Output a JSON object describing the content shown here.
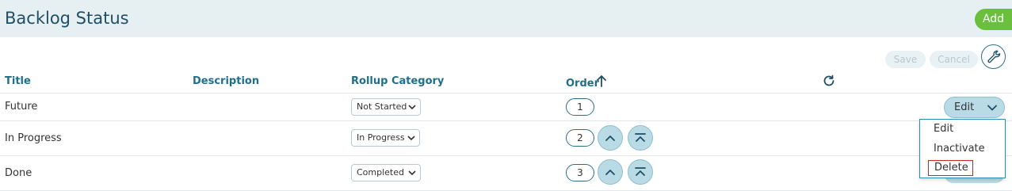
{
  "header": {
    "title": "Backlog Status",
    "add_label": "Add"
  },
  "toolbar": {
    "save_label": "Save",
    "cancel_label": "Cancel"
  },
  "columns": {
    "title": "Title",
    "description": "Description",
    "rollup": "Rollup Category",
    "order": "Order"
  },
  "rows": [
    {
      "title": "Future",
      "description": "",
      "rollup": "Not Started",
      "order": "1"
    },
    {
      "title": "In Progress",
      "description": "",
      "rollup": "In Progress",
      "order": "2"
    },
    {
      "title": "Done",
      "description": "",
      "rollup": "Completed",
      "order": "3"
    }
  ],
  "row_action": {
    "label": "Edit"
  },
  "menu": {
    "items": [
      "Edit",
      "Inactivate",
      "Delete"
    ]
  },
  "colors": {
    "accent": "#6abf3c",
    "header_bg": "#e6f0f3",
    "link": "#1f6f8b",
    "button_bg": "#b9dbe5",
    "delete_outline": "#c62828"
  }
}
